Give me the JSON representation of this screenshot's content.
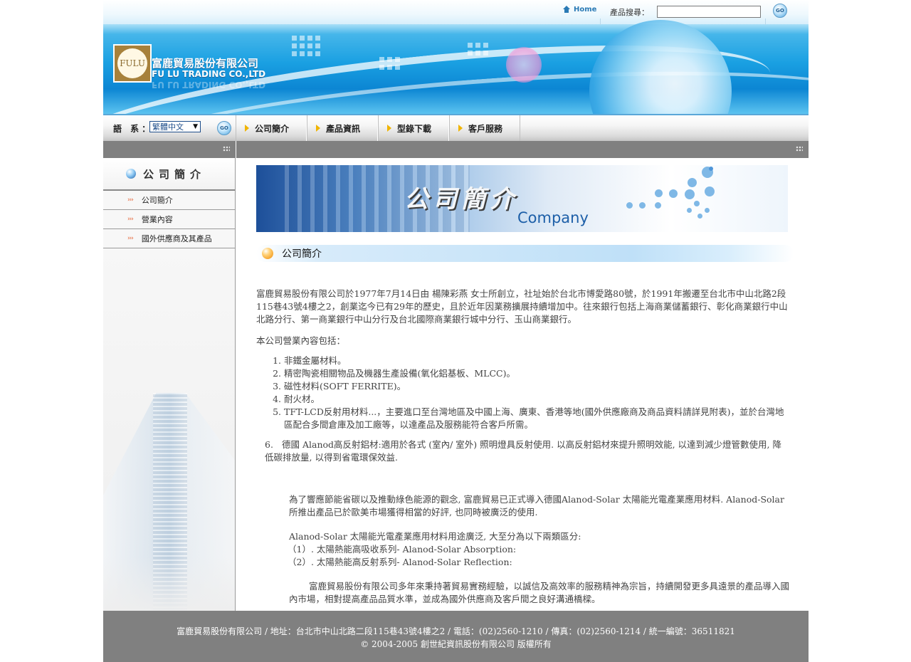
{
  "header": {
    "logo_mark": "FULU",
    "company_cn": "富鹿貿易股份有限公司",
    "company_en": "FU LU TRADING CO.,LTD",
    "home_label": "Home",
    "search_label": "產品搜尋：",
    "search_value": "",
    "go_label": "GO"
  },
  "navbar": {
    "lang_label": "語 系：",
    "lang_selected": "繁體中文",
    "lang_arrow": "▼",
    "go_label": "GO",
    "items": [
      {
        "label": "公司簡介"
      },
      {
        "label": "產品資訊"
      },
      {
        "label": "型錄下載"
      },
      {
        "label": "客戶服務"
      }
    ]
  },
  "sidebar": {
    "title": "公司簡介",
    "items": [
      {
        "marker": "›››",
        "label": "公司簡介"
      },
      {
        "marker": "›››",
        "label": "營業內容"
      },
      {
        "marker": "›››",
        "label": "國外供應商及其產品"
      }
    ]
  },
  "main": {
    "banner_title": "公司簡介",
    "banner_en": "Company",
    "section_title": "公司簡介",
    "intro": "富鹿貿易股份有限公司於1977年7月14日由 楊陳彩燕 女士所創立，社址始於台北市博愛路80號，於1991年搬遷至台北市中山北路2段115巷43號4樓之2，創業迄今已有29年的歷史，且於近年因業務擴展持續增加中。往來銀行包括上海商業儲蓄銀行、彰化商業銀行中山北路分行、第一商業銀行中山分行及台北國際商業銀行城中分行、玉山商業銀行。",
    "scope_intro": "本公司營業內容包括：",
    "scope_items": [
      "非鐵金屬材料。",
      "精密陶瓷相關物品及機器生產設備(氧化鋁基板、MLCC)。",
      "磁性材料(SOFT FERRITE)。",
      "耐火材。",
      "TFT-LCD反射用材料...，主要進口至台灣地區及中國上海、廣東、香港等地(國外供應廠商及商品資料請詳見附表)，並於台灣地區配合多間倉庫及加工廠等，以達產品及服務能符合客戶所需。"
    ],
    "item6_num": "6.",
    "item6_text": "德國 Alanod高反射鋁材:適用於各式 (室內/ 室外) 照明燈具反射使用. 以高反射鋁材來提升照明效能, 以達到減少燈管數使用, 降低碳排放量, 以得到省電環保效益.",
    "para_solar": "為了響應節能省碳以及推動綠色能源的觀念, 富鹿貿易已正式導入德國Alanod-Solar 太陽能光電產業應用材料. Alanod-Solar 所推出產品已於歐美市場獲得相當的好評, 也同時被廣泛的使用.",
    "para_solar2": "Alanod-Solar 太陽能光電產業應用材料用途廣泛, 大至分為以下兩類區分:",
    "solar_items": [
      "（1）. 太陽熱能高吸收系列- Alanod-Solar Absorption:",
      "（2）. 太陽熱能高反射系列- Alanod-Solar Reflection:"
    ],
    "closing": "富鹿貿易股份有限公司多年來秉持著貿易實務經驗，以誠信及高效率的服務精神為宗旨，持續開發更多具遠景的產品導入國內市場，相對提高產品品質水準，並成為國外供應商及客戶間之良好溝通橋樑。"
  },
  "footer": {
    "line1": "富鹿貿易股份有限公司 / 地址：台北市中山北路二段115巷43號4樓之2 / 電話：(02)2560-1210 / 傳真：(02)2560-1214 / 統一編號：36511821",
    "line2": "© 2004-2005 創世紀資訊股份有限公司 版權所有"
  }
}
